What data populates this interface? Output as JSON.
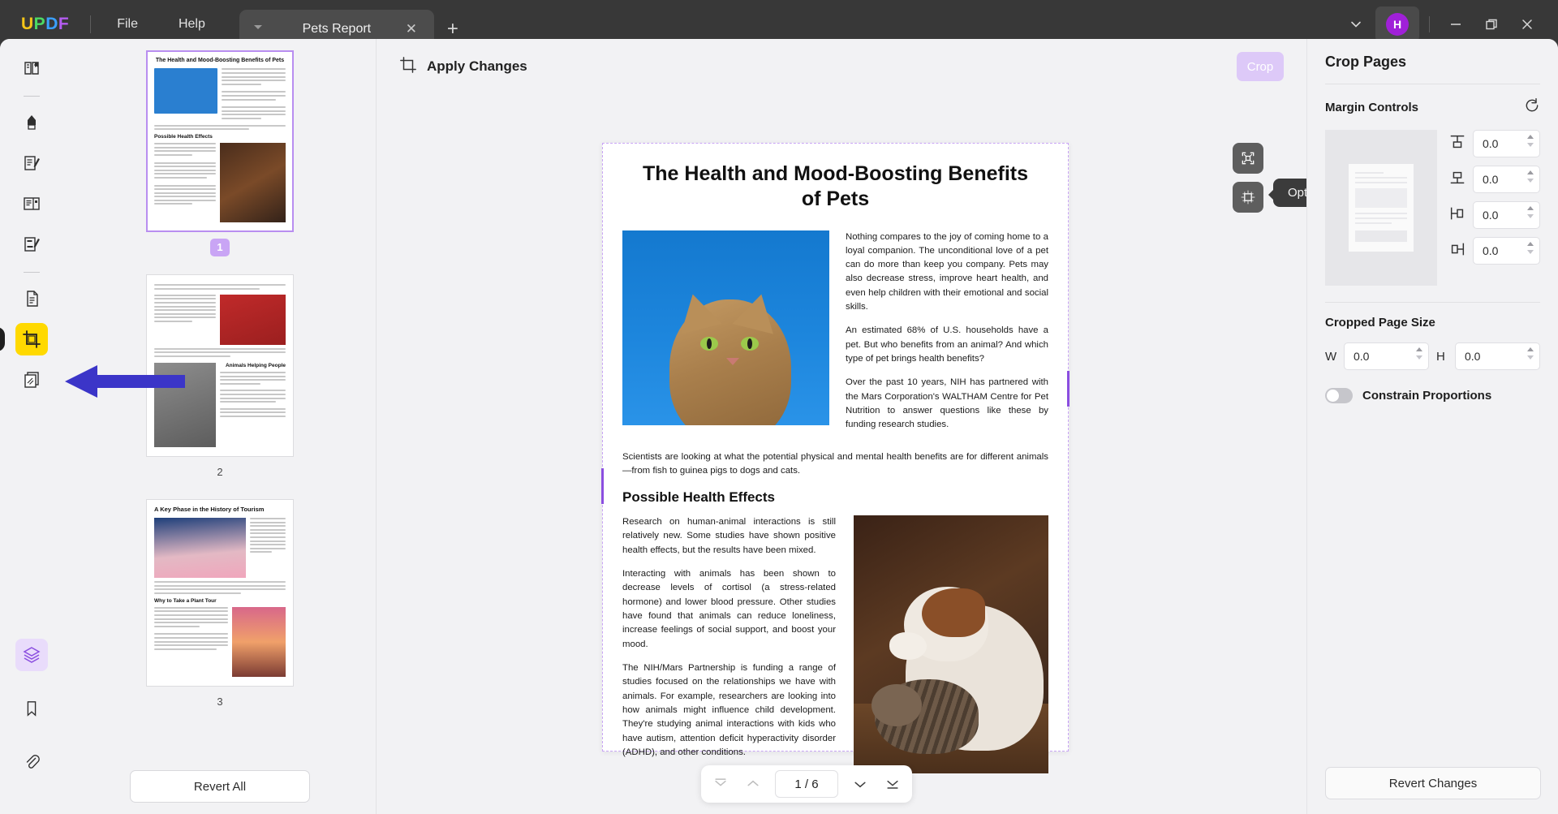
{
  "titlebar": {
    "logo": [
      "U",
      "P",
      "D",
      "F"
    ],
    "menus": [
      {
        "label": "File",
        "name": "menu-file"
      },
      {
        "label": "Help",
        "name": "menu-help"
      }
    ],
    "tab": {
      "title": "Pets Report",
      "close": "✕",
      "add": "+"
    },
    "avatar_initial": "H",
    "window_controls": {
      "minimize": "—",
      "maximize": "❐",
      "close": "✕"
    }
  },
  "rail": {
    "items": [
      {
        "name": "sidebar-reader-icon",
        "label": "Reader"
      },
      {
        "name": "sidebar-annotate-icon",
        "label": "Comment"
      },
      {
        "name": "sidebar-edit-icon",
        "label": "Edit PDF"
      },
      {
        "name": "sidebar-page-layout-icon",
        "label": "Page Layout"
      },
      {
        "name": "sidebar-form-icon",
        "label": "Form"
      },
      {
        "name": "sidebar-organize-icon",
        "label": "Organize Pages"
      },
      {
        "name": "sidebar-crop-icon",
        "label": "Crop Pages"
      },
      {
        "name": "sidebar-batch-icon",
        "label": "Batch"
      }
    ],
    "bottom": [
      {
        "name": "layers-icon",
        "label": "Layers"
      },
      {
        "name": "bookmark-icon",
        "label": "Bookmarks"
      },
      {
        "name": "attachment-icon",
        "label": "Attachments"
      }
    ]
  },
  "thumbnails": {
    "revert_all_label": "Revert All",
    "pages": [
      {
        "num": "1",
        "title": "The Health and Mood-Boosting Benefits of Pets",
        "subtitle": "Possible Health Effects",
        "selected": true
      },
      {
        "num": "2",
        "title": "",
        "subtitle": "Animals Helping People",
        "selected": false
      },
      {
        "num": "3",
        "title": "A Key Phase in the History of Tourism",
        "subtitle": "Why to Take a Plant Tour",
        "selected": false
      }
    ]
  },
  "toolbar": {
    "apply_changes_label": "Apply Changes",
    "crop_button_label": "Crop"
  },
  "float_tools": {
    "move_label": "Move",
    "options_label": "Options",
    "tooltip": "Options"
  },
  "document": {
    "title": "The Health and Mood-Boosting Benefits of Pets",
    "paragraphs": [
      "Nothing compares to the joy of coming home to a loyal companion. The unconditional love of a pet can do more than keep you company. Pets may also decrease stress, improve heart health, and even help children with their emotional and social skills.",
      "An estimated 68% of U.S. households have a pet. But who benefits from an animal? And which type of pet brings health benefits?",
      "Over the past 10 years, NIH has partnered with the Mars Corporation's WALTHAM Centre for Pet Nutrition to answer questions like these by funding research studies."
    ],
    "caption": "Scientists are looking at what the potential physical and mental health benefits are for different animals—from fish to guinea pigs to dogs and cats.",
    "section_heading": "Possible Health Effects",
    "section_paragraphs": [
      "Research on human-animal interactions is still relatively new. Some studies have shown positive health effects, but the results have been mixed.",
      "Interacting with animals has been shown to decrease levels of cortisol (a stress-related hormone) and lower blood pressure. Other studies have found that animals can reduce loneliness, increase feelings of social support, and boost your mood.",
      "The NIH/Mars Partnership is funding a range of studies focused on the relationships we have with animals. For example, researchers are looking into how animals might influence child development. They're studying animal interactions with kids who have autism, attention deficit hyperactivity disorder (ADHD), and other conditions."
    ]
  },
  "pagenav": {
    "first": "first-page",
    "prev": "previous-page",
    "value": "1 / 6",
    "next": "next-page",
    "last": "last-page"
  },
  "right_panel": {
    "title": "Crop Pages",
    "margin_section": "Margin Controls",
    "reset_icon": "reset-icon",
    "margins": [
      {
        "name": "margin-top",
        "icon": "margin-top-icon",
        "value": "0.0"
      },
      {
        "name": "margin-bottom",
        "icon": "margin-bottom-icon",
        "value": "0.0"
      },
      {
        "name": "margin-left",
        "icon": "margin-left-icon",
        "value": "0.0"
      },
      {
        "name": "margin-right",
        "icon": "margin-right-icon",
        "value": "0.0"
      }
    ],
    "size_section": "Cropped Page Size",
    "width_label": "W",
    "width_value": "0.0",
    "height_label": "H",
    "height_value": "0.0",
    "constrain_label": "Constrain Proportions",
    "constrain_on": false,
    "revert_changes_label": "Revert Changes"
  },
  "colors": {
    "accent_purple": "#8b4ee0",
    "crop_yellow": "#ffd900",
    "arrow_blue": "#3b35c8",
    "titlebar_bg": "#383838",
    "panel_bg": "#f2f2f4"
  }
}
